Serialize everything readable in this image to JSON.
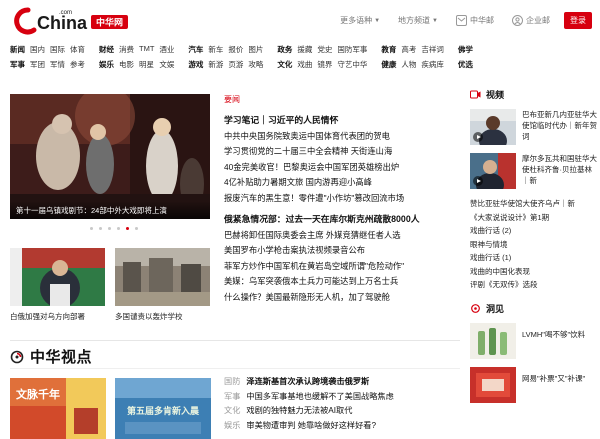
{
  "brand": {
    "logo_text": "China",
    "logo_com": ".com",
    "logo_badge": "中华网",
    "accent_color": "#d7000f"
  },
  "topbar": {
    "languages_label": "更多语种",
    "regions_label": "地方频道",
    "account_label": "中华邮",
    "enterprise_label": "企业邮",
    "login_label": "登录"
  },
  "nav": {
    "groups": [
      [
        "新闻",
        "国内",
        "国际",
        "体育",
        "军事",
        "军团",
        "军情",
        "参考"
      ],
      [
        "财经",
        "消费",
        "TMT",
        "酒业",
        "娱乐",
        "电影",
        "明星",
        "文娱"
      ],
      [
        "汽车",
        "新车",
        "报价",
        "图片",
        "游戏",
        "新游",
        "页游",
        "攻略"
      ],
      [
        "政务",
        "援藏",
        "党史",
        "国防军事",
        "文化",
        "戏曲",
        "镜界",
        "守艺中华"
      ],
      [
        "教育",
        "高考",
        "吉祥词",
        "健康",
        "人物",
        "疾病库"
      ],
      [
        "佛学",
        "优选"
      ]
    ]
  },
  "hero": {
    "caption": "第十一届乌镇戏剧节：24部中外大戏即将上演",
    "dots_total": 6,
    "dots_active": 5
  },
  "thumbs": [
    {
      "caption": "白俄加强对乌方向部署"
    },
    {
      "caption": "多国谴责以轰炸学校"
    }
  ],
  "news": {
    "section_label": "要闻",
    "headlines": [
      {
        "text": "学习笔记｜习近平的人民情怀",
        "bold": true
      },
      {
        "text": "中共中央国务院致奥运中国体育代表团的贺电",
        "bold": false
      },
      {
        "text": "学习贯彻党的二十届三中全会精神 天街连山海",
        "bold": false
      },
      {
        "text": "40金完美收官！巴黎奥运会中国军团英雄榜出炉",
        "bold": false
      },
      {
        "text": "4亿补贴助力暑期文旅 国内游再迎小高峰",
        "bold": false
      },
      {
        "text": "报废汽车的黑生意！零件遭\"小作坊\"篡改回流市场",
        "bold": false
      }
    ],
    "headlines2": [
      {
        "text": "俄紧急情况部：过去一天在库尔斯克州疏散8000人",
        "bold": true
      },
      {
        "text": "巴赫将卸任国际奥委会主席 外媒竞猜继任者人选",
        "bold": false
      },
      {
        "text": "美国罗布小学枪击案执法视频录音公布",
        "bold": false
      },
      {
        "text": "菲军方炒作中国军机在黄岩岛空域所谓\"危险动作\"",
        "bold": false
      },
      {
        "text": "美媒：乌军突袭俄本土兵力可能达到上万名士兵",
        "bold": false
      },
      {
        "text": "什么操作？美国最新隐形无人机，加了驾驶舱",
        "bold": false
      }
    ]
  },
  "video": {
    "heading": "视频",
    "items": [
      {
        "text": "巴布亚新几内亚驻华大使馆临时代办｜新年贺词"
      },
      {
        "text": "摩尔多瓦共和国驻华大使杜科齐鲁·贝拉基林｜新"
      }
    ],
    "links": [
      "赞比亚驻华使馆大使齐乌卢｜新",
      "《大家说说设计》第1期",
      "戏曲行话 (2)",
      "眼神与情境",
      "戏曲行话 (1)",
      "戏曲的中国化表现",
      "评剧《无双传》选段"
    ]
  },
  "dongjian": {
    "heading": "洞见",
    "items": [
      {
        "text": "LVMH\"喝不够\"饮料"
      },
      {
        "text": "网易\"补票\"又\"补课\""
      }
    ]
  },
  "zhonghua": {
    "title": "中华视点",
    "thumb1_text": "文脉千年",
    "thumb2_text": "第五届多肯新入晨",
    "items": [
      {
        "cat": "国防",
        "text": "泽连斯基首次承认跨境袭击俄罗斯",
        "bold": true
      },
      {
        "cat": "军事",
        "text": "中国多军事基地也缓解不了美国战略焦虑",
        "bold": false
      },
      {
        "cat": "文化",
        "text": "戏剧的独特魅力无法被AI取代",
        "bold": false
      },
      {
        "cat": "娱乐",
        "text": "审美物遭审判 她靠啥做好这样好看?",
        "bold": false
      }
    ]
  }
}
